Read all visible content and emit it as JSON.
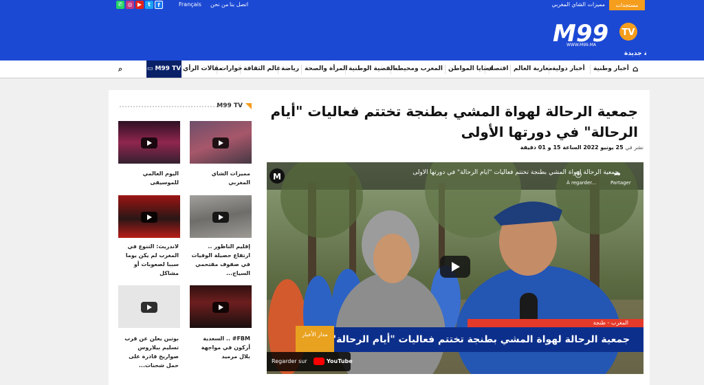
{
  "topbar": {
    "urgent_label": "مستجدات",
    "ticker_text": "مميزات الشاي المغربي",
    "links": [
      "اتصل بنا",
      "من نحن",
      "Français"
    ]
  },
  "logo": {
    "brand": "M99",
    "badge": "TV",
    "url": "WWW.M99.MA",
    "tagline": "قناة مغربية برؤية جديدة"
  },
  "nav": {
    "items": [
      "أخبار وطنية",
      "أخبار دولية",
      "مغاربة العالم",
      "اقتصاد",
      "قضايا المواطن",
      "المغرب ومحيطه",
      "القضية الوطنية",
      "المرأة والصحة",
      "رياضة",
      "عالم الثقافة",
      "حوارات",
      "مقالات الرأي"
    ],
    "tv_label": "M99 TV"
  },
  "article": {
    "title": "جمعية الرحالة لهواة المشي بطنجة تختتم فعاليات \"أيام الرحالة\" في دورتها الأولى",
    "meta_prefix": "نشر في",
    "meta_date": "25 يونيو 2022 الساعة 15 و 01 دقيقة"
  },
  "video": {
    "header_title": "جمعية الرحالة لهواة المشي بطنجة تختتم فعاليات \"أيام الرحالة\" في دورتها الأولى",
    "watch_later": "À regarder...",
    "share": "Partager",
    "lower_location": "المغرب - طنجة",
    "lower_title": "جمعية الرحالة لهواة المشي بطنجة تختتم فعاليات \"أيام الرحالة\" في دورتها الأولى",
    "lower_tag": "مدار الأخبار",
    "watch_on": "Regarder sur",
    "youtube": "YouTube"
  },
  "sidebar": {
    "heading": "M99 TV",
    "items": [
      {
        "caption": "مميزات الشاي المغربي"
      },
      {
        "caption": "اليوم العالمي للموسيقى"
      },
      {
        "caption": "إقليم الناظور .. ارتفاع حصيلة الوفيات في صفوف مقتحمي السياج..."
      },
      {
        "caption": "لاندريث: التنوع في المغرب لم يكن يوما سببا لصعوبات أو مشاكل"
      },
      {
        "caption": "FBM# .. السعدية أزكون في مواجهة بلال مرميد"
      },
      {
        "caption": "بوتين يعلن عن قرب تسليم بيلاروس صواريخ قادرة على حمل شحنات..."
      }
    ]
  }
}
